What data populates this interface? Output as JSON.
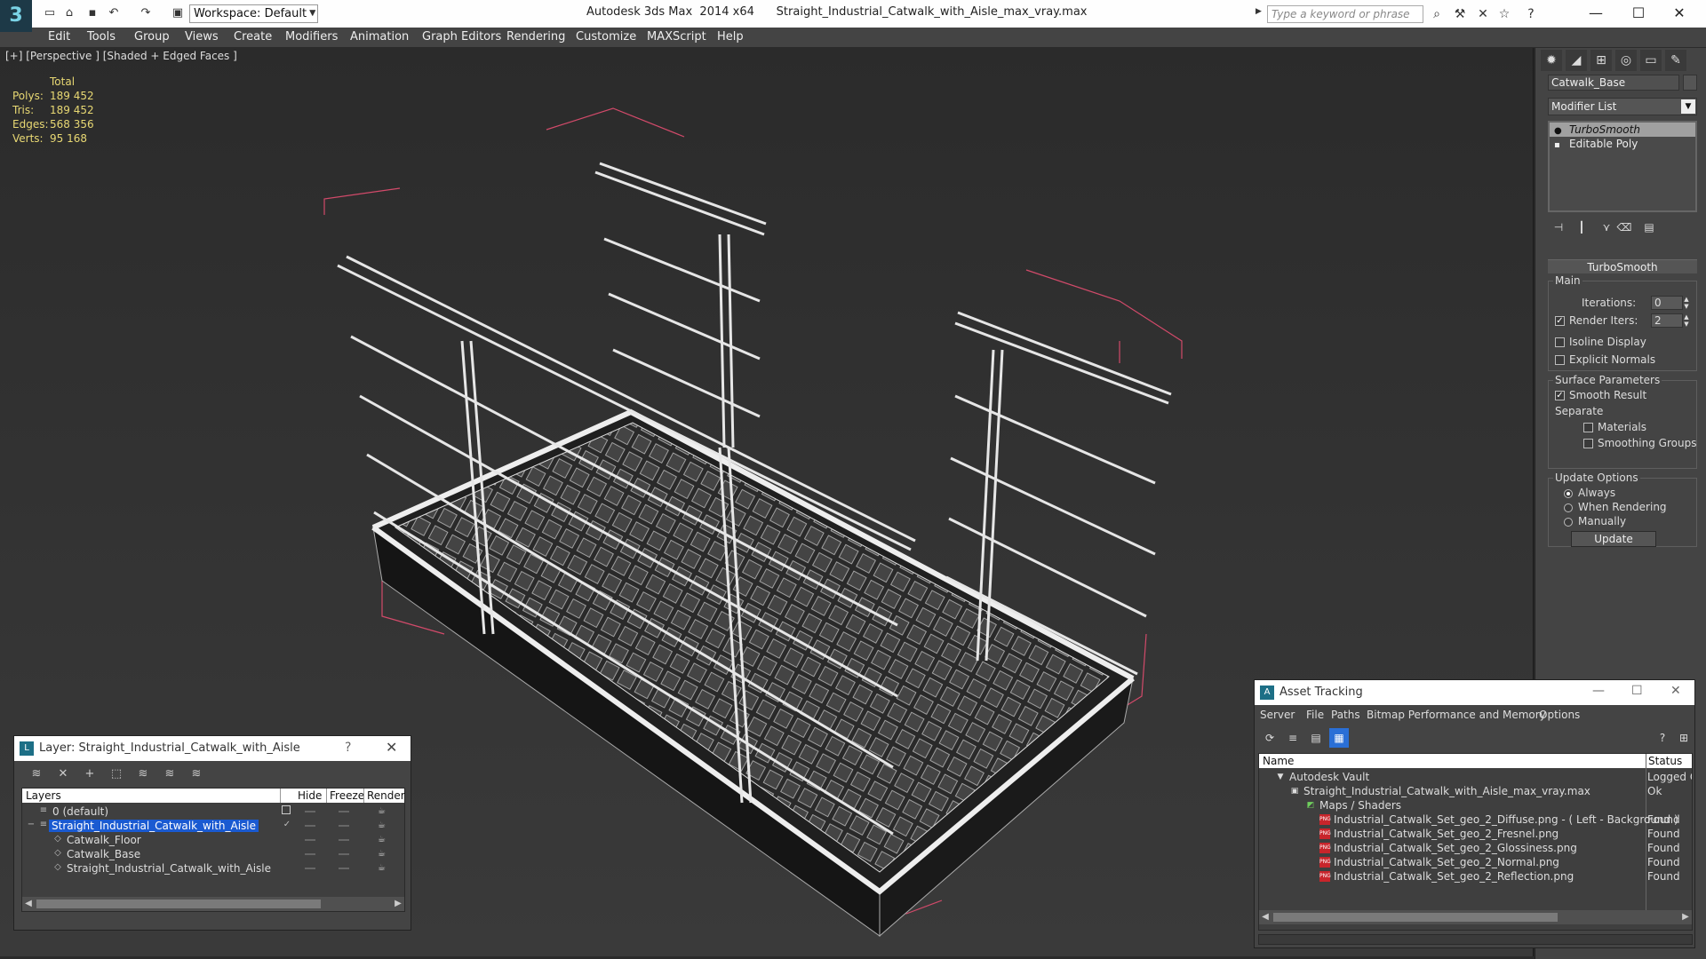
{
  "app": {
    "title": "Autodesk 3ds Max  2014 x64      Straight_Industrial_Catwalk_with_Aisle_max_vray.max",
    "workspace": "Workspace: Default",
    "search_placeholder": "Type a keyword or phrase"
  },
  "menu": [
    "Edit",
    "Tools",
    "Group",
    "Views",
    "Create",
    "Modifiers",
    "Animation",
    "Graph Editors",
    "Rendering",
    "Customize",
    "MAXScript",
    "Help"
  ],
  "viewport": {
    "label": "[+] [Perspective ] [Shaded + Edged Faces ]",
    "stats": {
      "header": "Total",
      "rows": [
        {
          "k": "Polys:",
          "v": "189 452"
        },
        {
          "k": "Tris:",
          "v": "189 452"
        },
        {
          "k": "Edges:",
          "v": "568 356"
        },
        {
          "k": "Verts:",
          "v": "95 168"
        }
      ]
    }
  },
  "command_panel": {
    "object_name": "Catwalk_Base",
    "modifier_list": "Modifier List",
    "stack": [
      "TurboSmooth",
      "Editable Poly"
    ],
    "rollout": "TurboSmooth",
    "main": {
      "label": "Main",
      "iterations_label": "Iterations:",
      "iterations": "0",
      "render_iters_label": "Render Iters:",
      "render_iters": "2",
      "render_iters_checked": true,
      "isoline": "Isoline Display",
      "explicit_normals": "Explicit Normals"
    },
    "surface": {
      "label": "Surface Parameters",
      "smooth_result": "Smooth Result",
      "separate": "Separate",
      "materials": "Materials",
      "smoothing_groups": "Smoothing Groups"
    },
    "update": {
      "label": "Update Options",
      "always": "Always",
      "when_rendering": "When Rendering",
      "manually": "Manually",
      "button": "Update"
    }
  },
  "layer_window": {
    "title": "Layer: Straight_Industrial_Catwalk_with_Aisle",
    "help": "?",
    "columns": [
      "Layers",
      "Hide",
      "Freeze",
      "Render"
    ],
    "rows": [
      {
        "name": "0 (default)",
        "indent": 0,
        "selected": false
      },
      {
        "name": "Straight_Industrial_Catwalk_with_Aisle",
        "indent": 0,
        "selected": true
      },
      {
        "name": "Catwalk_Floor",
        "indent": 1,
        "selected": false
      },
      {
        "name": "Catwalk_Base",
        "indent": 1,
        "selected": false
      },
      {
        "name": "Straight_Industrial_Catwalk_with_Aisle",
        "indent": 1,
        "selected": false
      }
    ]
  },
  "asset_window": {
    "title": "Asset Tracking",
    "menu": [
      "Server",
      "File",
      "Paths",
      "Bitmap Performance and Memory",
      "Options"
    ],
    "columns": [
      "Name",
      "Status"
    ],
    "rows": [
      {
        "name": "Autodesk Vault",
        "status": "Logged O",
        "indent": 0,
        "icon": "vault"
      },
      {
        "name": "Straight_Industrial_Catwalk_with_Aisle_max_vray.max",
        "status": "Ok",
        "indent": 1,
        "icon": "file"
      },
      {
        "name": "Maps / Shaders",
        "status": "",
        "indent": 2,
        "icon": "folder"
      },
      {
        "name": "Industrial_Catwalk_Set_geo_2_Diffuse.png - ( Left - Background )",
        "status": "Found",
        "indent": 3,
        "icon": "png"
      },
      {
        "name": "Industrial_Catwalk_Set_geo_2_Fresnel.png",
        "status": "Found",
        "indent": 3,
        "icon": "png"
      },
      {
        "name": "Industrial_Catwalk_Set_geo_2_Glossiness.png",
        "status": "Found",
        "indent": 3,
        "icon": "png"
      },
      {
        "name": "Industrial_Catwalk_Set_geo_2_Normal.png",
        "status": "Found",
        "indent": 3,
        "icon": "png"
      },
      {
        "name": "Industrial_Catwalk_Set_geo_2_Reflection.png",
        "status": "Found",
        "indent": 3,
        "icon": "png"
      }
    ]
  },
  "icons": {
    "logo": "3ds-max-logo",
    "quick_access": [
      "new-icon",
      "open-icon",
      "save-icon",
      "undo-icon",
      "redo-icon",
      "project-folder-icon"
    ],
    "infocenter": [
      "binoculars-icon",
      "tools-icon",
      "exchange-icon",
      "star-icon",
      "help-icon"
    ]
  },
  "colors": {
    "selection": "#1a5ad1",
    "stats_text": "#e8d873",
    "bbox": "#d24a6a"
  }
}
